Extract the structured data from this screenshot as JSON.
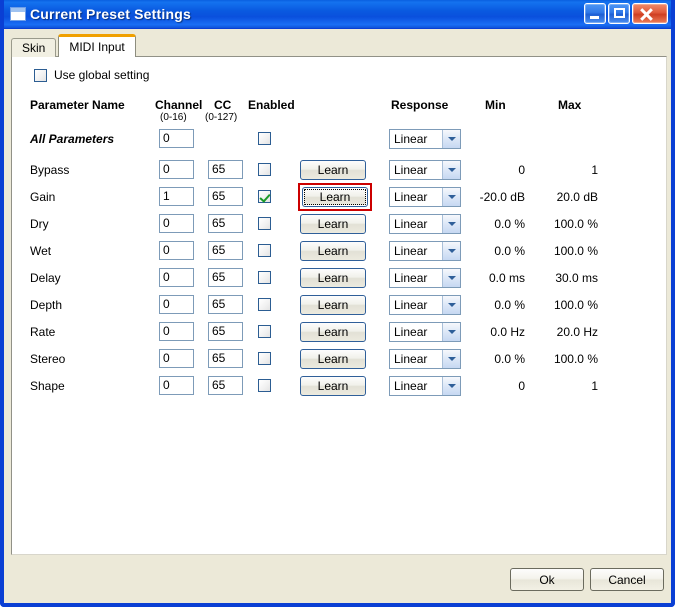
{
  "window": {
    "title": "Current Preset Settings",
    "icon": "window-icon",
    "buttons": {
      "minimize": "minimize-icon",
      "maximize": "maximize-icon",
      "close": "close-icon"
    },
    "frame_color": "#0a3fd4",
    "titlebar_color": "#0a5ae0"
  },
  "tabs": [
    {
      "label": "Skin",
      "active": false
    },
    {
      "label": "MIDI Input",
      "active": true
    }
  ],
  "accent_color": "#f0a000",
  "global_setting": {
    "label": "Use global setting",
    "checked": false
  },
  "table": {
    "headers": {
      "name": "Parameter Name",
      "channel": "Channel",
      "channel_sub": "(0-16)",
      "cc": "CC",
      "cc_sub": "(0-127)",
      "enabled": "Enabled",
      "response": "Response",
      "min": "Min",
      "max": "Max"
    },
    "learn_label": "Learn",
    "response_default": "Linear",
    "response_options": [
      "Linear"
    ],
    "rows": [
      {
        "name": "All Parameters",
        "emphasis": true,
        "channel": "0",
        "cc": "",
        "enabled": false,
        "has_learn": false,
        "response": "Linear",
        "min": "",
        "max": ""
      },
      {
        "name": "Bypass",
        "emphasis": false,
        "channel": "0",
        "cc": "65",
        "enabled": false,
        "has_learn": true,
        "focused": false,
        "response": "Linear",
        "min": "0",
        "max": "1"
      },
      {
        "name": "Gain",
        "emphasis": false,
        "channel": "1",
        "cc": "65",
        "enabled": true,
        "has_learn": true,
        "focused": true,
        "response": "Linear",
        "min": "-20.0 dB",
        "max": "20.0 dB"
      },
      {
        "name": "Dry",
        "emphasis": false,
        "channel": "0",
        "cc": "65",
        "enabled": false,
        "has_learn": true,
        "focused": false,
        "response": "Linear",
        "min": "0.0 %",
        "max": "100.0 %"
      },
      {
        "name": "Wet",
        "emphasis": false,
        "channel": "0",
        "cc": "65",
        "enabled": false,
        "has_learn": true,
        "focused": false,
        "response": "Linear",
        "min": "0.0 %",
        "max": "100.0 %"
      },
      {
        "name": "Delay",
        "emphasis": false,
        "channel": "0",
        "cc": "65",
        "enabled": false,
        "has_learn": true,
        "focused": false,
        "response": "Linear",
        "min": "0.0 ms",
        "max": "30.0 ms"
      },
      {
        "name": "Depth",
        "emphasis": false,
        "channel": "0",
        "cc": "65",
        "enabled": false,
        "has_learn": true,
        "focused": false,
        "response": "Linear",
        "min": "0.0 %",
        "max": "100.0 %"
      },
      {
        "name": "Rate",
        "emphasis": false,
        "channel": "0",
        "cc": "65",
        "enabled": false,
        "has_learn": true,
        "focused": false,
        "response": "Linear",
        "min": "0.0 Hz",
        "max": "20.0 Hz"
      },
      {
        "name": "Stereo",
        "emphasis": false,
        "channel": "0",
        "cc": "65",
        "enabled": false,
        "has_learn": true,
        "focused": false,
        "response": "Linear",
        "min": "0.0 %",
        "max": "100.0 %"
      },
      {
        "name": "Shape",
        "emphasis": false,
        "channel": "0",
        "cc": "65",
        "enabled": false,
        "has_learn": true,
        "focused": false,
        "response": "Linear",
        "min": "0",
        "max": "1"
      }
    ]
  },
  "footer": {
    "ok": "Ok",
    "cancel": "Cancel"
  },
  "highlight_color": "#cc0000"
}
